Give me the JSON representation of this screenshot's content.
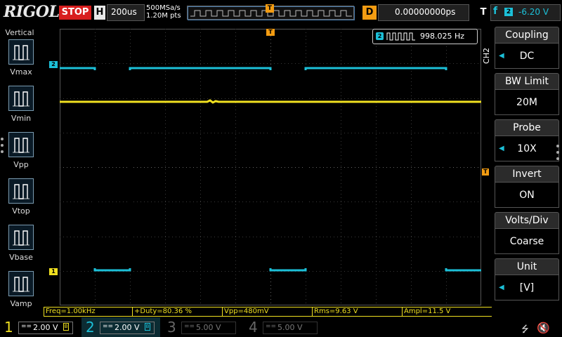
{
  "brand": "RIGOL",
  "run_state": "STOP",
  "timebase": {
    "key": "H",
    "value": "200us"
  },
  "sample": {
    "rate": "500MSa/s",
    "points": "1.20M pts"
  },
  "trigger_marker": "T",
  "delay": {
    "key": "D",
    "value": "0.00000000ps"
  },
  "trigger": {
    "key": "T",
    "edge": "f",
    "source": "2",
    "level": "-6.20 V"
  },
  "left_menu": {
    "title": "Vertical",
    "items": [
      {
        "label": "Vmax",
        "icon": "vmax-icon"
      },
      {
        "label": "Vmin",
        "icon": "vmin-icon"
      },
      {
        "label": "Vpp",
        "icon": "vpp-icon"
      },
      {
        "label": "Vtop",
        "icon": "vtop-icon"
      },
      {
        "label": "Vbase",
        "icon": "vbase-icon"
      },
      {
        "label": "Vamp",
        "icon": "vamp-icon"
      }
    ]
  },
  "freq_counter": {
    "source": "2",
    "value": "998.025 Hz"
  },
  "channel_label": "CH2",
  "right_menu": [
    {
      "title": "Coupling",
      "value": "DC",
      "arrow": true
    },
    {
      "title": "BW Limit",
      "value": "20M",
      "arrow": false
    },
    {
      "title": "Probe",
      "value": "10X",
      "arrow": true
    },
    {
      "title": "Invert",
      "value": "ON",
      "arrow": false
    },
    {
      "title": "Volts/Div",
      "value": "Coarse",
      "arrow": false
    },
    {
      "title": "Unit",
      "value": "[V]",
      "arrow": true
    }
  ],
  "measurements": [
    "Freq=1.00kHz",
    "+Duty=80.36 %",
    "Vpp=480mV",
    "Rms=9.63 V",
    "Ampl=11.5 V"
  ],
  "channels": [
    {
      "num": "1",
      "coupling": "==",
      "scale": "2.00 V",
      "color": "#f0e020",
      "active": true
    },
    {
      "num": "2",
      "coupling": "==",
      "scale": "2.00 V",
      "color": "#1cc0d8",
      "active": true
    },
    {
      "num": "3",
      "coupling": "==",
      "scale": "5.00 V",
      "color": "#b04fc0",
      "active": false
    },
    {
      "num": "4",
      "coupling": "==",
      "scale": "5.00 V",
      "color": "#3a7bd5",
      "active": false
    }
  ],
  "colors": {
    "ch1": "#f0e020",
    "ch2": "#1cc0d8",
    "trigger": "#f39c12",
    "stop": "#d81e1e"
  }
}
